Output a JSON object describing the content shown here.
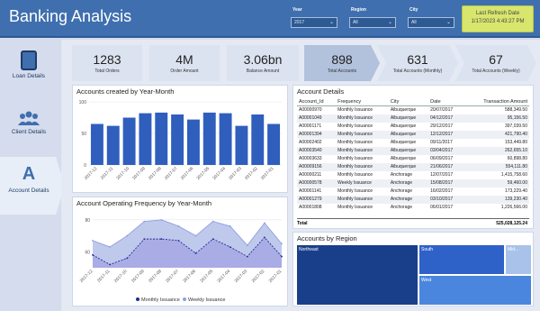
{
  "header": {
    "title": "Banking Analysis",
    "filters": [
      {
        "label": "Year",
        "value": "2017"
      },
      {
        "label": "Region",
        "value": "All"
      },
      {
        "label": "City",
        "value": "All"
      }
    ],
    "refresh": {
      "label": "Last Refresh Date",
      "value": "1/17/2023 4:43:27 PM"
    }
  },
  "sidebar": {
    "items": [
      {
        "label": "Loan Details",
        "icon": "document-icon"
      },
      {
        "label": "Client Details",
        "icon": "users-icon"
      },
      {
        "label": "Account Details",
        "icon": "letter-a-icon",
        "active": true
      }
    ]
  },
  "kpis": [
    {
      "value": "1283",
      "label": "Total Orders"
    },
    {
      "value": "4M",
      "label": "Order Amount"
    },
    {
      "value": "3.06bn",
      "label": "Balance Amount"
    },
    {
      "value": "898",
      "label": "Total Accounts"
    },
    {
      "value": "631",
      "label": "Total Accounts (Monthly)"
    },
    {
      "value": "67",
      "label": "Total Accounts (Weekly)"
    }
  ],
  "colors": {
    "header": "#3f6fae",
    "bar": "#2f5ebd",
    "monthly": "#1f2f8f",
    "weekly": "#8f9fe0",
    "refresh": "#d8e66d"
  },
  "chart_data": [
    {
      "type": "bar",
      "title": "Accounts created by Year-Month",
      "categories": [
        "2017-12",
        "2017-11",
        "2017-10",
        "2017-09",
        "2017-08",
        "2017-07",
        "2017-06",
        "2017-05",
        "2017-04",
        "2017-03",
        "2017-02",
        "2017-01"
      ],
      "values": [
        65,
        62,
        75,
        82,
        83,
        80,
        72,
        83,
        82,
        62,
        80,
        65
      ],
      "ylim": [
        0,
        100
      ],
      "yticks": [
        0,
        50,
        100
      ],
      "grid": true
    },
    {
      "type": "area",
      "title": "Account Operating Frequency by Year-Month",
      "categories": [
        "2017-12",
        "2017-11",
        "2017-10",
        "2017-09",
        "2017-08",
        "2017-07",
        "2017-06",
        "2017-05",
        "2017-04",
        "2017-03",
        "2017-02",
        "2017-01"
      ],
      "series": [
        {
          "name": "Monthly Issuance",
          "values": [
            58,
            52,
            56,
            68,
            68,
            67,
            59,
            68,
            63,
            57,
            69,
            57
          ]
        },
        {
          "name": "Weekly Issuance",
          "values": [
            67,
            63,
            70,
            79,
            80,
            76,
            70,
            79,
            76,
            64,
            78,
            65
          ]
        }
      ],
      "ylim": [
        50,
        85
      ],
      "yticks": [
        60,
        80
      ],
      "legend": "bottom"
    }
  ],
  "account_table": {
    "title": "Account Details",
    "columns": [
      "Account_Id",
      "Frequency",
      "City",
      "Date",
      "Transaction Amount"
    ],
    "rows": [
      [
        "A00000970",
        "Monthly Issuance",
        "Albuquerque",
        "20/07/2017",
        "588,349.50"
      ],
      [
        "A00001049",
        "Monthly Issuance",
        "Albuquerque",
        "04/12/2017",
        "95,156.50"
      ],
      [
        "A00001171",
        "Monthly Issuance",
        "Albuquerque",
        "29/12/2017",
        "397,039.50"
      ],
      [
        "A00001394",
        "Monthly Issuance",
        "Albuquerque",
        "12/12/2017",
        "421,790.40"
      ],
      [
        "A00002402",
        "Monthly Issuance",
        "Albuquerque",
        "09/11/2017",
        "153,449.80"
      ],
      [
        "A00003540",
        "Monthly Issuance",
        "Albuquerque",
        "03/04/2017",
        "262,655.10"
      ],
      [
        "A00003633",
        "Monthly Issuance",
        "Albuquerque",
        "06/09/2017",
        "60,898.80"
      ],
      [
        "A00009156",
        "Monthly Issuance",
        "Albuquerque",
        "21/06/2017",
        "554,111.80"
      ],
      [
        "A00000211",
        "Monthly Issuance",
        "Anchorage",
        "12/07/2017",
        "1,415,758.60"
      ],
      [
        "A00000578",
        "Weekly Issuance",
        "Anchorage",
        "15/08/2017",
        "59,460.00"
      ],
      [
        "A00001141",
        "Monthly Issuance",
        "Anchorage",
        "16/02/2017",
        "173,229.40"
      ],
      [
        "A00001279",
        "Monthly Issuance",
        "Anchorage",
        "03/10/2017",
        "139,230.40"
      ],
      [
        "A00001808",
        "Monthly Issuance",
        "Anchorage",
        "06/01/2017",
        "1,226,566.00"
      ]
    ],
    "total_label": "Total",
    "total_value": "525,028,125.24"
  },
  "treemap": {
    "title": "Accounts by Region",
    "regions": [
      "Northeast",
      "South",
      "Mid...",
      "West"
    ]
  }
}
